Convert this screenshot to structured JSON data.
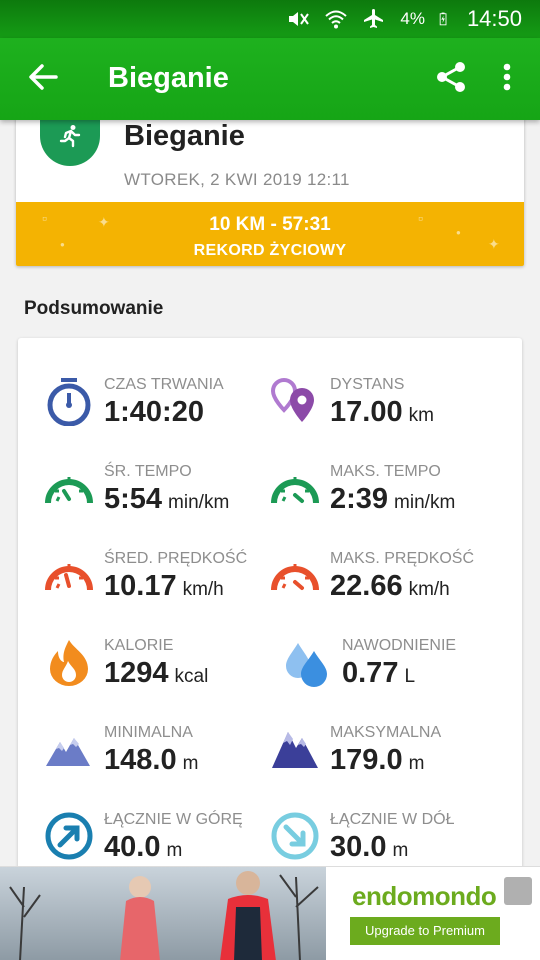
{
  "status_bar": {
    "battery_percent": "4%",
    "time": "14:50"
  },
  "app_bar": {
    "title": "Bieganie"
  },
  "activity": {
    "name": "Bieganie",
    "date": "WTOREK, 2 KWI 2019 12:11"
  },
  "record": {
    "main": "10 KM  -  57:31",
    "sub": "REKORD ŻYCIOWY"
  },
  "summary": {
    "title": "Podsumowanie",
    "stats": [
      {
        "label": "CZAS TRWANIA",
        "value": "1:40:20",
        "unit": "",
        "icon": "stopwatch-icon"
      },
      {
        "label": "DYSTANS",
        "value": "17.00",
        "unit": "km",
        "icon": "location-pins-icon"
      },
      {
        "label": "ŚR. TEMPO",
        "value": "5:54",
        "unit": "min/km",
        "icon": "pace-gauge-icon"
      },
      {
        "label": "MAKS. TEMPO",
        "value": "2:39",
        "unit": "min/km",
        "icon": "max-pace-gauge-icon"
      },
      {
        "label": "ŚRED. PRĘDKOŚĆ",
        "value": "10.17",
        "unit": "km/h",
        "icon": "speed-gauge-icon"
      },
      {
        "label": "MAKS. PRĘDKOŚĆ",
        "value": "22.66",
        "unit": "km/h",
        "icon": "max-speed-gauge-icon"
      },
      {
        "label": "KALORIE",
        "value": "1294",
        "unit": "kcal",
        "icon": "flame-icon"
      },
      {
        "label": "NAWODNIENIE",
        "value": "0.77",
        "unit": "L",
        "icon": "water-drops-icon"
      },
      {
        "label": "MINIMALNA",
        "value": "148.0",
        "unit": "m",
        "icon": "low-mountain-icon"
      },
      {
        "label": "MAKSYMALNA",
        "value": "179.0",
        "unit": "m",
        "icon": "high-mountain-icon"
      },
      {
        "label": "ŁĄCZNIE W GÓRĘ",
        "value": "40.0",
        "unit": "m",
        "icon": "ascent-arrow-icon"
      },
      {
        "label": "ŁĄCZNIE W DÓŁ",
        "value": "30.0",
        "unit": "m",
        "icon": "descent-arrow-icon"
      }
    ]
  },
  "ad": {
    "brand": "endomondo",
    "cta": "Upgrade to Premium"
  },
  "colors": {
    "app_bar": "#1eb11e",
    "record_banner": "#f4b302",
    "activity_icon": "#1c9a55",
    "stopwatch": "#3b5aa8",
    "pins": "#8c4aa8",
    "pace": "#1c9a55",
    "speed": "#e8502c",
    "flame": "#f28c1e",
    "water": "#3b8fe0",
    "mountain_low": "#6b7cc7",
    "mountain_high": "#3b3f99",
    "ascent": "#1a7fb0",
    "descent": "#78cde0",
    "ad_green": "#6cab1e"
  }
}
